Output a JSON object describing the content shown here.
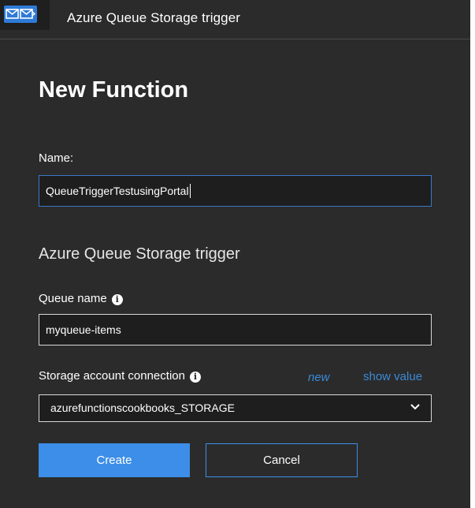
{
  "header": {
    "icon": "queue-storage-icon",
    "title": "Azure Queue Storage trigger"
  },
  "form": {
    "page_title": "New Function",
    "name_label": "Name:",
    "name_value": "QueueTriggerTestusingPortal",
    "section_title": "Azure Queue Storage trigger",
    "queue_name_label": "Queue name",
    "queue_name_value": "myqueue-items",
    "storage_label": "Storage account connection",
    "new_link": "new",
    "show_value_link": "show value",
    "storage_value": "azurefunctionscookbooks_STORAGE",
    "create_label": "Create",
    "cancel_label": "Cancel"
  },
  "colors": {
    "panel_bg": "#2b2b2b",
    "accent": "#3c8ee8",
    "link": "#3a8ad8"
  }
}
